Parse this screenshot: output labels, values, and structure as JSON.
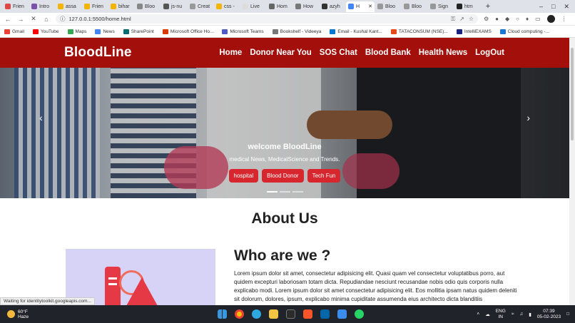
{
  "browser": {
    "tabs": [
      {
        "label": "Frien"
      },
      {
        "label": "Intro"
      },
      {
        "label": "assa"
      },
      {
        "label": "Frien"
      },
      {
        "label": "bihar"
      },
      {
        "label": "Bloo"
      },
      {
        "label": "js-nu"
      },
      {
        "label": "Creat"
      },
      {
        "label": "css -"
      },
      {
        "label": "Live"
      },
      {
        "label": "Hom"
      },
      {
        "label": "How"
      },
      {
        "label": "azyh"
      },
      {
        "label": "H"
      },
      {
        "label": "Bloo"
      },
      {
        "label": "Bloo"
      },
      {
        "label": "Sign"
      },
      {
        "label": "htm"
      }
    ],
    "new_tab_label": "+",
    "url": "127.0.0.1:5500/home.html",
    "bookmarks": [
      {
        "label": "Gmail",
        "color": "#ea4335"
      },
      {
        "label": "YouTube",
        "color": "#ff0000"
      },
      {
        "label": "Maps",
        "color": "#34a853"
      },
      {
        "label": "News",
        "color": "#4285f4"
      },
      {
        "label": "SharePoint",
        "color": "#036c70"
      },
      {
        "label": "Microsoft Office Ho...",
        "color": "#d83b01"
      },
      {
        "label": "Microsoft Teams",
        "color": "#5059c9"
      },
      {
        "label": "Bookshelf - Videeya",
        "color": "#777777"
      },
      {
        "label": "Email - Kushal Kant...",
        "color": "#0078d4"
      },
      {
        "label": "TATACONSUM (NSE)...",
        "color": "#e64a19"
      },
      {
        "label": "IntelliEXAMS",
        "color": "#1a237e"
      },
      {
        "label": "Cloud computing -...",
        "color": "#1976d2"
      }
    ]
  },
  "site": {
    "brand": "BloodLine",
    "nav": [
      "Home",
      "Donor Near You",
      "SOS Chat",
      "Blood Bank",
      "Health News",
      "LogOut"
    ],
    "hero": {
      "heading": "welcome BloodLine",
      "subheading": "medical News, MedicalScience and Trends.",
      "buttons": [
        "hospital",
        "Blood Donor",
        "Tech Fun"
      ]
    },
    "about": {
      "title": "About Us",
      "who_title": "Who are we ?",
      "who_text": "Lorem ipsum dolor sit amet, consectetur adipisicing elit. Quasi quam vel consectetur voluptatibus porro, aut quidem excepturi laboriosam totam dicta. Repudiandae nesciunt recusandae nobis odio quis corporis nulla explicabo modi. Lorem ipsum dolor sit amet consectetur adipisicing elit. Eos mollitia ipsam natus quidem deleniti sit dolorum, dolores, ipsum, explicabo minima cupiditate assumenda eius architecto dicta blanditiis"
    }
  },
  "status_text": "Waiting for identitytoolkit.googleapis.com...",
  "taskbar": {
    "weather_temp": "60°F",
    "weather_desc": "Haze",
    "lang_line1": "ENG",
    "lang_line2": "IN",
    "time": "07:39",
    "date": "05-02-2023"
  },
  "colors": {
    "brand_red": "#a3100c",
    "button_red": "#d7262e"
  }
}
